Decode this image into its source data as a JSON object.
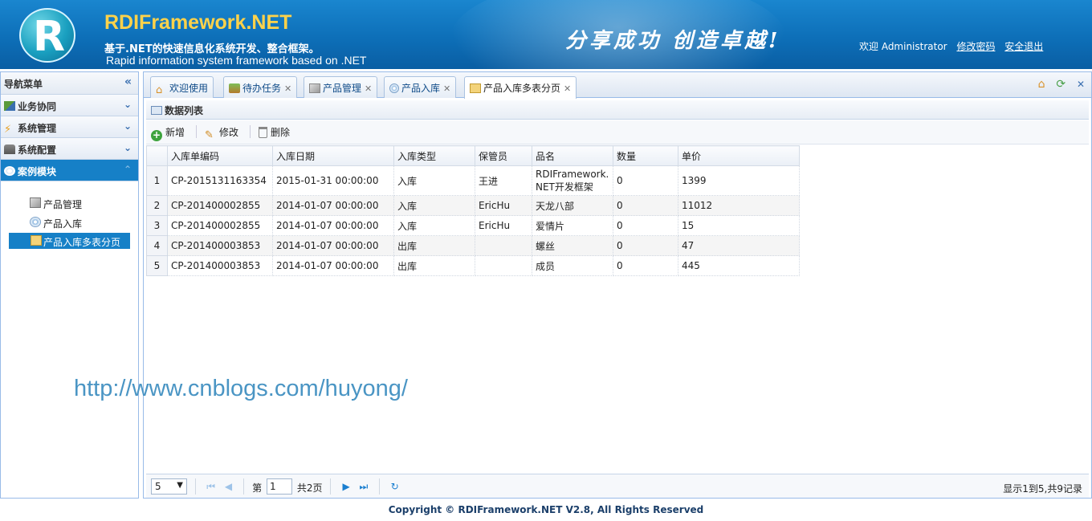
{
  "header": {
    "brand": "RDIFramework.NET",
    "logo_letter": "R",
    "subtitle_cn": "基于.NET的快速信息化系统开发、整合框架。",
    "subtitle_en": "Rapid information system framework based on .NET",
    "slogan": "分享成功  创造卓越!",
    "welcome": "欢迎 Administrator",
    "change_password": "修改密码",
    "logout": "安全退出"
  },
  "nav": {
    "title": "导航菜单",
    "collapse_glyph": "«",
    "sections": [
      {
        "label": "业务协同",
        "icon": "business-icon"
      },
      {
        "label": "系统管理",
        "icon": "lightning-icon"
      },
      {
        "label": "系统配置",
        "icon": "config-icon"
      },
      {
        "label": "案例模块",
        "icon": "case-icon",
        "active": true
      }
    ],
    "tree": [
      {
        "label": "产品管理",
        "icon": "box-icon"
      },
      {
        "label": "产品入库",
        "icon": "disc-icon"
      },
      {
        "label": "产品入库多表分页",
        "icon": "table-icon",
        "selected": true
      }
    ]
  },
  "tabs": [
    {
      "label": "欢迎使用",
      "icon": "home-icon",
      "closable": false
    },
    {
      "label": "待办任务",
      "icon": "task-icon",
      "closable": true
    },
    {
      "label": "产品管理",
      "icon": "box-icon",
      "closable": true
    },
    {
      "label": "产品入库",
      "icon": "disc-icon",
      "closable": true
    },
    {
      "label": "产品入库多表分页",
      "icon": "table-icon",
      "closable": true,
      "active": true
    }
  ],
  "panel": {
    "title": "数据列表",
    "toolbar": {
      "add": "新增",
      "edit": "修改",
      "delete": "删除"
    }
  },
  "grid": {
    "columns": [
      "入库单编码",
      "入库日期",
      "入库类型",
      "保管员",
      "品名",
      "数量",
      "单价"
    ],
    "rows": [
      {
        "n": "1",
        "code": "CP-2015131163354",
        "date": "2015-01-31 00:00:00",
        "type": "入库",
        "keeper": "王进",
        "name": "RDIFramework.NET开发框架",
        "qty": "0",
        "price": "1399"
      },
      {
        "n": "2",
        "code": "CP-201400002855",
        "date": "2014-01-07 00:00:00",
        "type": "入库",
        "keeper": "EricHu",
        "name": "天龙八部",
        "qty": "0",
        "price": "11012"
      },
      {
        "n": "3",
        "code": "CP-201400002855",
        "date": "2014-01-07 00:00:00",
        "type": "入库",
        "keeper": "EricHu",
        "name": "爱情片",
        "qty": "0",
        "price": "15"
      },
      {
        "n": "4",
        "code": "CP-201400003853",
        "date": "2014-01-07 00:00:00",
        "type": "出库",
        "keeper": "",
        "name": "螺丝",
        "qty": "0",
        "price": "47"
      },
      {
        "n": "5",
        "code": "CP-201400003853",
        "date": "2014-01-07 00:00:00",
        "type": "出库",
        "keeper": "",
        "name": "成员",
        "qty": "0",
        "price": "445"
      }
    ]
  },
  "watermark": "http://www.cnblogs.com/huyong/",
  "pager": {
    "page_size": "5",
    "page_prefix": "第",
    "page_value": "1",
    "page_total": "共2页",
    "info": "显示1到5,共9记录"
  },
  "footer": "Copyright © RDIFramework.NET V2.8, All Rights Reserved",
  "colors": {
    "header_blue": "#1a86cf",
    "accent_blue": "#1680c7",
    "border_blue": "#99bbe8",
    "brand_yellow": "#ffd24a"
  }
}
